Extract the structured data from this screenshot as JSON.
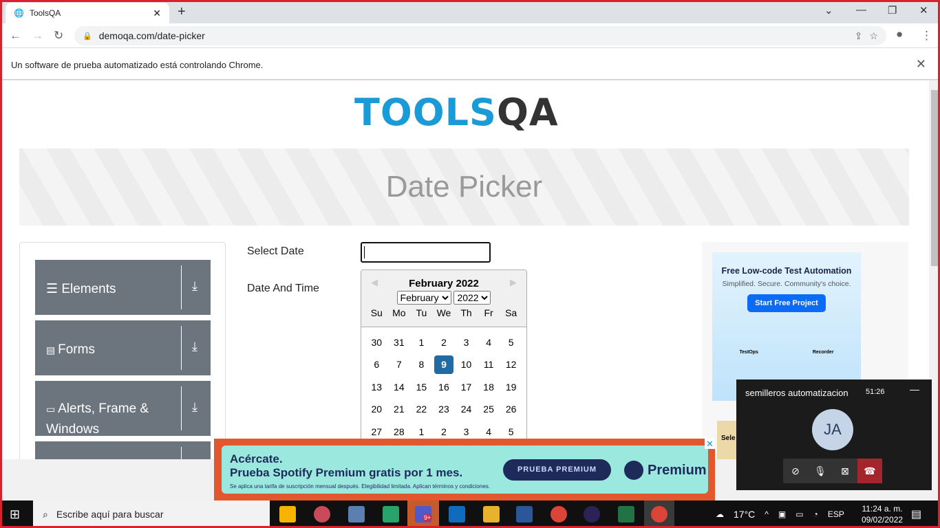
{
  "browser": {
    "tab_title": "ToolsQA",
    "url": "demoqa.com/date-picker",
    "infobar": "Un software de prueba automatizado está controlando Chrome."
  },
  "page": {
    "logo": "TOOLSQA",
    "title": "Date Picker",
    "sidebar": [
      {
        "label": "Elements",
        "icon": "list-icon"
      },
      {
        "label": "Forms",
        "icon": "form-icon"
      },
      {
        "label": "Alerts, Frame & Windows",
        "icon": "window-icon"
      },
      {
        "label": ""
      }
    ],
    "select_date_label": "Select Date",
    "date_and_time_label": "Date And Time",
    "select_date_value": "",
    "calendar": {
      "header": "February 2022",
      "month_select": "February",
      "year_select": "2022",
      "day_names": [
        "Su",
        "Mo",
        "Tu",
        "We",
        "Th",
        "Fr",
        "Sa"
      ],
      "weeks": [
        [
          "30",
          "31",
          "1",
          "2",
          "3",
          "4",
          "5"
        ],
        [
          "6",
          "7",
          "8",
          "9",
          "10",
          "11",
          "12"
        ],
        [
          "13",
          "14",
          "15",
          "16",
          "17",
          "18",
          "19"
        ],
        [
          "20",
          "21",
          "22",
          "23",
          "24",
          "25",
          "26"
        ],
        [
          "27",
          "28",
          "1",
          "2",
          "3",
          "4",
          "5"
        ]
      ],
      "selected": "9"
    },
    "side_ad": {
      "title": "Free Low-code Test Automation",
      "subtitle": "Simplified. Secure. Community's choice.",
      "button": "Start Free Project",
      "labels": [
        "TestOps",
        "Recorder"
      ],
      "partial": "Sele"
    },
    "spotify_ad": {
      "headline1": "Acércate.",
      "headline2": "Prueba Spotify Premium gratis por 1 mes.",
      "button": "PRUEBA PREMIUM",
      "brand": "Premium",
      "fine_print": "Se aplica una tarifa de suscripción mensual después. Elegibilidad limitada. Aplican términos y condiciones."
    }
  },
  "teams": {
    "meeting": "semilleros automatizacion",
    "duration": "51:26",
    "avatar": "JA"
  },
  "taskbar": {
    "search_placeholder": "Escribe aquí para buscar",
    "temperature": "17°C",
    "language": "ESP",
    "time": "11:24 a. m.",
    "date": "09/02/2022",
    "badge": "9+"
  },
  "colors": {
    "accent": "#216ba5",
    "sidebar": "#6c757d",
    "frame": "#d9202c"
  }
}
